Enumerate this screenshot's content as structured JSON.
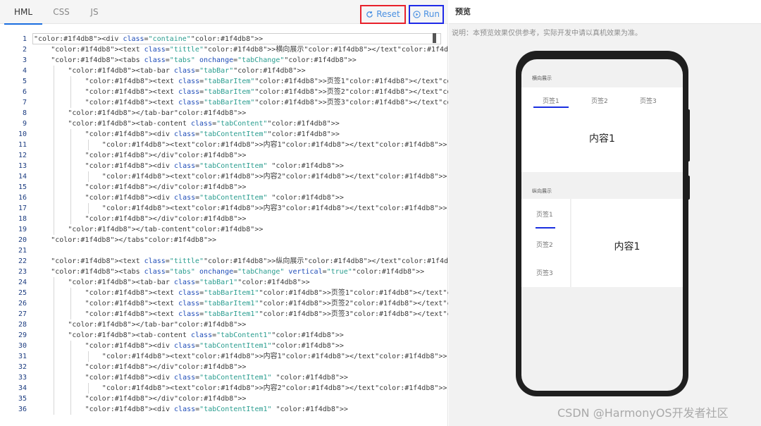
{
  "editor": {
    "tabs": [
      {
        "label": "HML",
        "active": true
      },
      {
        "label": "CSS",
        "active": false
      },
      {
        "label": "JS",
        "active": false
      }
    ],
    "reset_label": "Reset",
    "run_label": "Run",
    "lines": [
      {
        "n": "1",
        "indent": 0,
        "text": "<div class=\"containe\">"
      },
      {
        "n": "2",
        "indent": 1,
        "text": "<text class=\"tittle\">横向展示</text>"
      },
      {
        "n": "3",
        "indent": 1,
        "text": "<tabs class=\"tabs\" onchange=\"tabChange\">"
      },
      {
        "n": "4",
        "indent": 2,
        "text": "<tab-bar class=\"tabBar\">"
      },
      {
        "n": "5",
        "indent": 3,
        "text": "<text class=\"tabBarItem\">页签1</text>"
      },
      {
        "n": "6",
        "indent": 3,
        "text": "<text class=\"tabBarItem\">页签2</text>"
      },
      {
        "n": "7",
        "indent": 3,
        "text": "<text class=\"tabBarItem\">页签3</text>"
      },
      {
        "n": "8",
        "indent": 2,
        "text": "</tab-bar>"
      },
      {
        "n": "9",
        "indent": 2,
        "text": "<tab-content class=\"tabContent\">"
      },
      {
        "n": "10",
        "indent": 3,
        "text": "<div class=\"tabContentItem\">"
      },
      {
        "n": "11",
        "indent": 4,
        "text": "<text>内容1</text>"
      },
      {
        "n": "12",
        "indent": 3,
        "text": "</div>"
      },
      {
        "n": "13",
        "indent": 3,
        "text": "<div class=\"tabContentItem\" >"
      },
      {
        "n": "14",
        "indent": 4,
        "text": "<text>内容2</text>"
      },
      {
        "n": "15",
        "indent": 3,
        "text": "</div>"
      },
      {
        "n": "16",
        "indent": 3,
        "text": "<div class=\"tabContentItem\" >"
      },
      {
        "n": "17",
        "indent": 4,
        "text": "<text>内容3</text>"
      },
      {
        "n": "18",
        "indent": 3,
        "text": "</div>"
      },
      {
        "n": "19",
        "indent": 2,
        "text": "</tab-content>"
      },
      {
        "n": "20",
        "indent": 1,
        "text": "</tabs>"
      },
      {
        "n": "21",
        "indent": 0,
        "text": ""
      },
      {
        "n": "22",
        "indent": 1,
        "text": "<text class=\"tittle\">纵向展示</text>"
      },
      {
        "n": "23",
        "indent": 1,
        "text": "<tabs class=\"tabs\" onchange=\"tabChange\" vertical=\"true\">"
      },
      {
        "n": "24",
        "indent": 2,
        "text": "<tab-bar class=\"tabBar1\">"
      },
      {
        "n": "25",
        "indent": 3,
        "text": "<text class=\"tabBarItem1\">页签1</text>"
      },
      {
        "n": "26",
        "indent": 3,
        "text": "<text class=\"tabBarItem1\">页签2</text>"
      },
      {
        "n": "27",
        "indent": 3,
        "text": "<text class=\"tabBarItem1\">页签3</text>"
      },
      {
        "n": "28",
        "indent": 2,
        "text": "</tab-bar>"
      },
      {
        "n": "29",
        "indent": 2,
        "text": "<tab-content class=\"tabContent1\">"
      },
      {
        "n": "30",
        "indent": 3,
        "text": "<div class=\"tabContentItem1\">"
      },
      {
        "n": "31",
        "indent": 4,
        "text": "<text>内容1</text>"
      },
      {
        "n": "32",
        "indent": 3,
        "text": "</div>"
      },
      {
        "n": "33",
        "indent": 3,
        "text": "<div class=\"tabContentItem1\" >"
      },
      {
        "n": "34",
        "indent": 4,
        "text": "<text>内容2</text>"
      },
      {
        "n": "35",
        "indent": 3,
        "text": "</div>"
      },
      {
        "n": "36",
        "indent": 3,
        "text": "<div class=\"tabContentItem1\" >"
      }
    ]
  },
  "preview": {
    "title": "预览",
    "note": "说明：本预览效果仅供参考，实际开发中请以真机效果为准。",
    "horizontal": {
      "title": "横向展示",
      "tabs": [
        "页签1",
        "页签2",
        "页签3"
      ],
      "active_index": 0,
      "content": "内容1"
    },
    "vertical": {
      "title": "纵向展示",
      "tabs": [
        "页签1",
        "页签2",
        "页签3"
      ],
      "active_index": 0,
      "content": "内容1"
    }
  },
  "watermark": "CSDN @HarmonyOS开发者社区",
  "colors": {
    "reset_border": "#e8212b",
    "run_border": "#1f2ae8",
    "active_tab_line": "#1a2fe0",
    "line_number": "#1c3c80"
  }
}
